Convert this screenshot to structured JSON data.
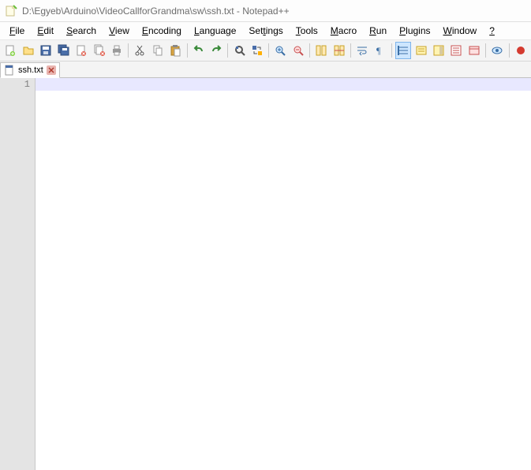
{
  "titlebar": {
    "path_title": "D:\\Egyeb\\Arduino\\VideoCallforGrandma\\sw\\ssh.txt - Notepad++"
  },
  "menu": {
    "items": [
      {
        "label": "File",
        "hotkey_index": 0
      },
      {
        "label": "Edit",
        "hotkey_index": 0
      },
      {
        "label": "Search",
        "hotkey_index": 0
      },
      {
        "label": "View",
        "hotkey_index": 0
      },
      {
        "label": "Encoding",
        "hotkey_index": 0
      },
      {
        "label": "Language",
        "hotkey_index": 0
      },
      {
        "label": "Settings",
        "hotkey_index": 3
      },
      {
        "label": "Tools",
        "hotkey_index": 0
      },
      {
        "label": "Macro",
        "hotkey_index": 0
      },
      {
        "label": "Run",
        "hotkey_index": 0
      },
      {
        "label": "Plugins",
        "hotkey_index": 0
      },
      {
        "label": "Window",
        "hotkey_index": 0
      },
      {
        "label": "?",
        "hotkey_index": 0
      }
    ]
  },
  "toolbar": {
    "buttons": [
      {
        "name": "new-file-icon"
      },
      {
        "name": "open-file-icon"
      },
      {
        "name": "save-icon"
      },
      {
        "name": "save-all-icon"
      },
      {
        "name": "close-icon"
      },
      {
        "name": "close-all-icon"
      },
      {
        "name": "print-icon"
      },
      {
        "sep": true
      },
      {
        "name": "cut-icon"
      },
      {
        "name": "copy-icon"
      },
      {
        "name": "paste-icon"
      },
      {
        "sep": true
      },
      {
        "name": "undo-icon"
      },
      {
        "name": "redo-icon"
      },
      {
        "sep": true
      },
      {
        "name": "find-icon"
      },
      {
        "name": "replace-icon"
      },
      {
        "sep": true
      },
      {
        "name": "zoom-in-icon"
      },
      {
        "name": "zoom-out-icon"
      },
      {
        "sep": true
      },
      {
        "name": "sync-vscroll-icon"
      },
      {
        "name": "sync-hscroll-icon"
      },
      {
        "sep": true
      },
      {
        "name": "word-wrap-icon"
      },
      {
        "name": "show-all-chars-icon"
      },
      {
        "sep": true
      },
      {
        "name": "indent-guide-icon",
        "active": true
      },
      {
        "name": "udl-icon"
      },
      {
        "name": "doc-map-icon"
      },
      {
        "name": "func-list-icon"
      },
      {
        "name": "folder-workspace-icon"
      },
      {
        "sep": true
      },
      {
        "name": "monitoring-icon"
      },
      {
        "sep": true
      },
      {
        "name": "record-macro-icon"
      }
    ]
  },
  "tabs": {
    "items": [
      {
        "label": "ssh.txt",
        "saved": true
      }
    ]
  },
  "editor": {
    "line_numbers": [
      "1"
    ],
    "lines": [
      ""
    ]
  }
}
